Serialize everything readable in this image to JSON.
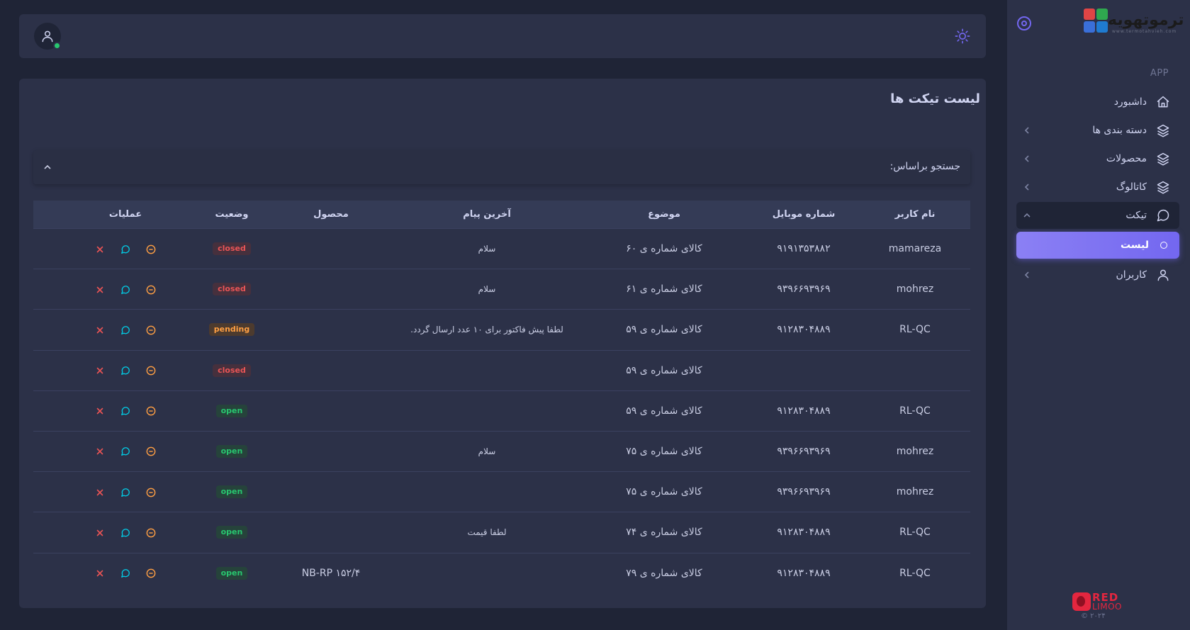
{
  "sidebar": {
    "brand": {
      "logo_text": "ترموتهویه",
      "logo_sub": "www.termotahvieh.com"
    },
    "section_label": "APP",
    "items": [
      {
        "label": "داشبورد",
        "icon": "home-icon"
      },
      {
        "label": "دسته بندی ها",
        "icon": "layers-icon"
      },
      {
        "label": "محصولات",
        "icon": "layers-icon"
      },
      {
        "label": "کاتالوگ",
        "icon": "layers-icon"
      },
      {
        "label": "تیکت",
        "icon": "message-circle-icon"
      },
      {
        "label": "لیست",
        "icon": "circle-icon"
      },
      {
        "label": "کاربران",
        "icon": "user-icon"
      }
    ],
    "footer": {
      "red": "RED",
      "limoo": "LIMOO",
      "year": "© ۲۰۲۴"
    }
  },
  "page": {
    "title": "لیست تیکت ها",
    "search_label": "جستجو براساس:"
  },
  "table": {
    "headers": {
      "user": "نام کاربر",
      "mobile": "شماره موبایل",
      "subject": "موضوع",
      "last_message": "آخرین پیام",
      "product": "محصول",
      "status": "وضعیت",
      "operations": "عملیات"
    },
    "rows": [
      {
        "user": "mamareza",
        "mobile": "۹۱۹۱۳۵۳۸۸۲",
        "subject": "کالای شماره ی ۶۰",
        "last_message": "سلام",
        "product": "",
        "status": "closed"
      },
      {
        "user": "mohrez",
        "mobile": "۹۳۹۶۶۹۳۹۶۹",
        "subject": "کالای شماره ی ۶۱",
        "last_message": "سلام",
        "product": "",
        "status": "closed"
      },
      {
        "user": "RL-QC",
        "mobile": "۹۱۲۸۳۰۴۸۸۹",
        "subject": "کالای شماره ی ۵۹",
        "last_message": "لطفا پیش فاکتور برای ۱۰ عدد ارسال گردد.",
        "product": "",
        "status": "pending"
      },
      {
        "user": "",
        "mobile": "",
        "subject": "کالای شماره ی ۵۹",
        "last_message": "",
        "product": "",
        "status": "closed"
      },
      {
        "user": "RL-QC",
        "mobile": "۹۱۲۸۳۰۴۸۸۹",
        "subject": "کالای شماره ی ۵۹",
        "last_message": "",
        "product": "",
        "status": "open"
      },
      {
        "user": "mohrez",
        "mobile": "۹۳۹۶۶۹۳۹۶۹",
        "subject": "کالای شماره ی ۷۵",
        "last_message": "سلام",
        "product": "",
        "status": "open"
      },
      {
        "user": "mohrez",
        "mobile": "۹۳۹۶۶۹۳۹۶۹",
        "subject": "کالای شماره ی ۷۵",
        "last_message": "",
        "product": "",
        "status": "open"
      },
      {
        "user": "RL-QC",
        "mobile": "۹۱۲۸۳۰۴۸۸۹",
        "subject": "کالای شماره ی ۷۴",
        "last_message": "لطفا قیمت",
        "product": "",
        "status": "open"
      },
      {
        "user": "RL-QC",
        "mobile": "۹۱۲۸۳۰۴۸۸۹",
        "subject": "کالای شماره ی ۷۹",
        "last_message": "",
        "product": "NB-RP ۱۵۲/۴",
        "status": "open"
      }
    ],
    "operation_icons": [
      "minus-circle-icon",
      "message-circle-icon",
      "close-icon"
    ]
  },
  "colors": {
    "accent": "#7367f0",
    "closed": "#ea5455",
    "pending": "#ff9f43",
    "open": "#28c76f",
    "chat": "#00cfe8"
  }
}
